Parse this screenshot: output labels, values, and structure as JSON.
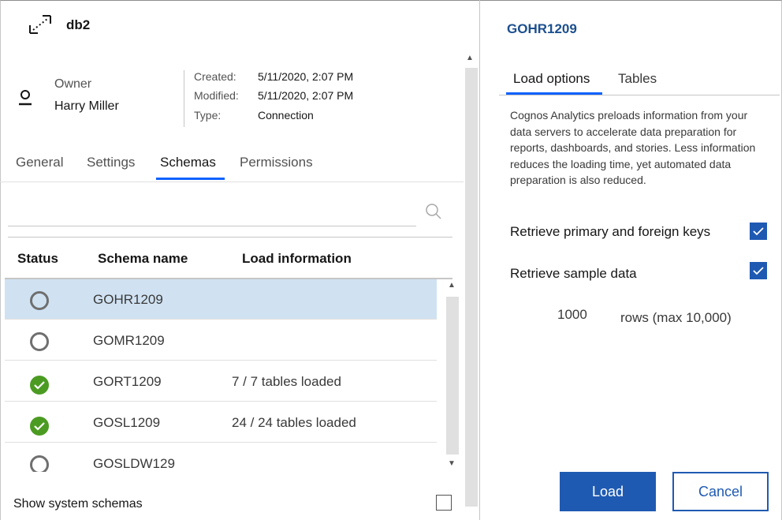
{
  "header": {
    "connection_name": "db2",
    "icon": "connection-icon"
  },
  "owner": {
    "label": "Owner",
    "name": "Harry Miller",
    "icon": "user-icon"
  },
  "meta": {
    "created_label": "Created:",
    "created_value": "5/11/2020, 2:07 PM",
    "modified_label": "Modified:",
    "modified_value": "5/11/2020, 2:07 PM",
    "type_label": "Type:",
    "type_value": "Connection"
  },
  "tabs": [
    {
      "label": "General",
      "active": false
    },
    {
      "label": "Settings",
      "active": false
    },
    {
      "label": "Schemas",
      "active": true
    },
    {
      "label": "Permissions",
      "active": false
    }
  ],
  "search": {
    "value": "",
    "placeholder": "",
    "icon": "search-icon"
  },
  "table": {
    "headers": [
      "Status",
      "Schema name",
      "Load information"
    ],
    "rows": [
      {
        "status": "not-loaded",
        "name": "GOHR1209",
        "load": "",
        "selected": true
      },
      {
        "status": "not-loaded",
        "name": "GOMR1209",
        "load": "",
        "selected": false
      },
      {
        "status": "loaded",
        "name": "GORT1209",
        "load": "7 / 7 tables loaded",
        "selected": false
      },
      {
        "status": "loaded",
        "name": "GOSL1209",
        "load": "24 / 24 tables loaded",
        "selected": false
      },
      {
        "status": "not-loaded",
        "name": "GOSLDW129",
        "load": "",
        "selected": false
      }
    ]
  },
  "footer": {
    "show_system_label": "Show system schemas",
    "show_system_checked": false
  },
  "panel": {
    "title": "GOHR1209",
    "tabs": [
      {
        "label": "Load options",
        "active": true
      },
      {
        "label": "Tables",
        "active": false
      }
    ],
    "description": "Cognos Analytics preloads information from your data servers to accelerate data preparation for reports, dashboards, and stories. Less information reduces the loading time, yet automated data preparation is also reduced.",
    "options": [
      {
        "label": "Retrieve primary and foreign keys",
        "checked": true
      },
      {
        "label": "Retrieve sample data",
        "checked": true
      }
    ],
    "rows_value": "1000",
    "rows_label": "rows (max 10,000)",
    "load_button": "Load",
    "cancel_button": "Cancel"
  },
  "colors": {
    "accent": "#0f62fe",
    "primary_button": "#1f5ab2",
    "title": "#1c4f8e",
    "selected_row": "#d0e2f2",
    "success": "#4b9b22"
  }
}
